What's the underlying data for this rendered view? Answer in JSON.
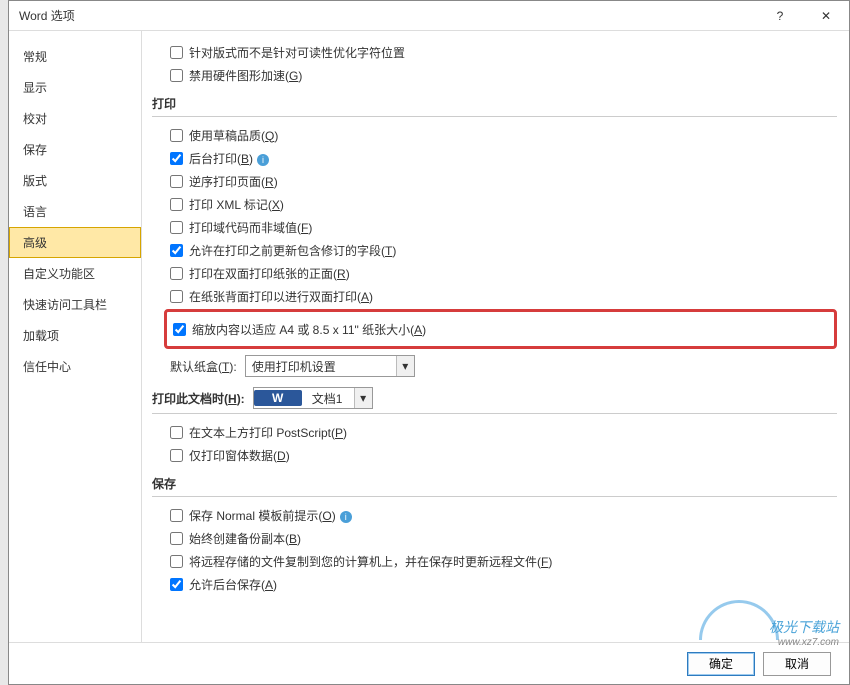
{
  "title": "Word 选项",
  "sidebar": [
    "常规",
    "显示",
    "校对",
    "保存",
    "版式",
    "语言",
    "高级",
    "自定义功能区",
    "快速访问工具栏",
    "加载项",
    "信任中心"
  ],
  "top": [
    "针对版式而不是针对可读性优化字符位置",
    {
      "pre": "禁用硬件图形加速",
      "key": "G"
    }
  ],
  "sections": {
    "print": "打印",
    "save": "保存"
  },
  "print": [
    {
      "pre": "使用草稿品质",
      "key": "Q"
    },
    {
      "pre": "后台打印",
      "key": "B"
    },
    {
      "pre": "逆序打印页面",
      "key": "R"
    },
    {
      "pre": "打印 XML 标记",
      "key": "X"
    },
    {
      "pre": "打印域代码而非域值",
      "key": "F"
    },
    {
      "pre": "允许在打印之前更新包含修订的字段",
      "key": "T"
    },
    {
      "pre": "打印在双面打印纸张的正面",
      "key": "R"
    },
    {
      "pre": "在纸张背面打印以进行双面打印",
      "key": "A"
    },
    {
      "pre": "缩放内容以适应 A4 或 8.5 x 11\" 纸张大小",
      "key": "A"
    }
  ],
  "tray": {
    "label": "默认纸盒",
    "key": "T",
    "value": "使用打印机设置"
  },
  "printDoc": {
    "label": "打印此文档时",
    "key": "H",
    "value": "文档1"
  },
  "printDocOpts": [
    {
      "pre": "在文本上方打印 PostScript",
      "key": "P"
    },
    {
      "pre": "仅打印窗体数据",
      "key": "D"
    }
  ],
  "save": [
    {
      "pre": "保存 Normal 模板前提示",
      "key": "O"
    },
    {
      "pre": "始终创建备份副本",
      "key": "B"
    },
    {
      "pre": "将远程存储的文件复制到您的计算机上，并在保存时更新远程文件",
      "key": "F"
    },
    {
      "pre": "允许后台保存",
      "key": "A"
    }
  ],
  "buttons": {
    "ok": "确定",
    "cancel": "取消"
  },
  "watermark": {
    "text": "极光下载站",
    "url": "www.xz7.com"
  }
}
